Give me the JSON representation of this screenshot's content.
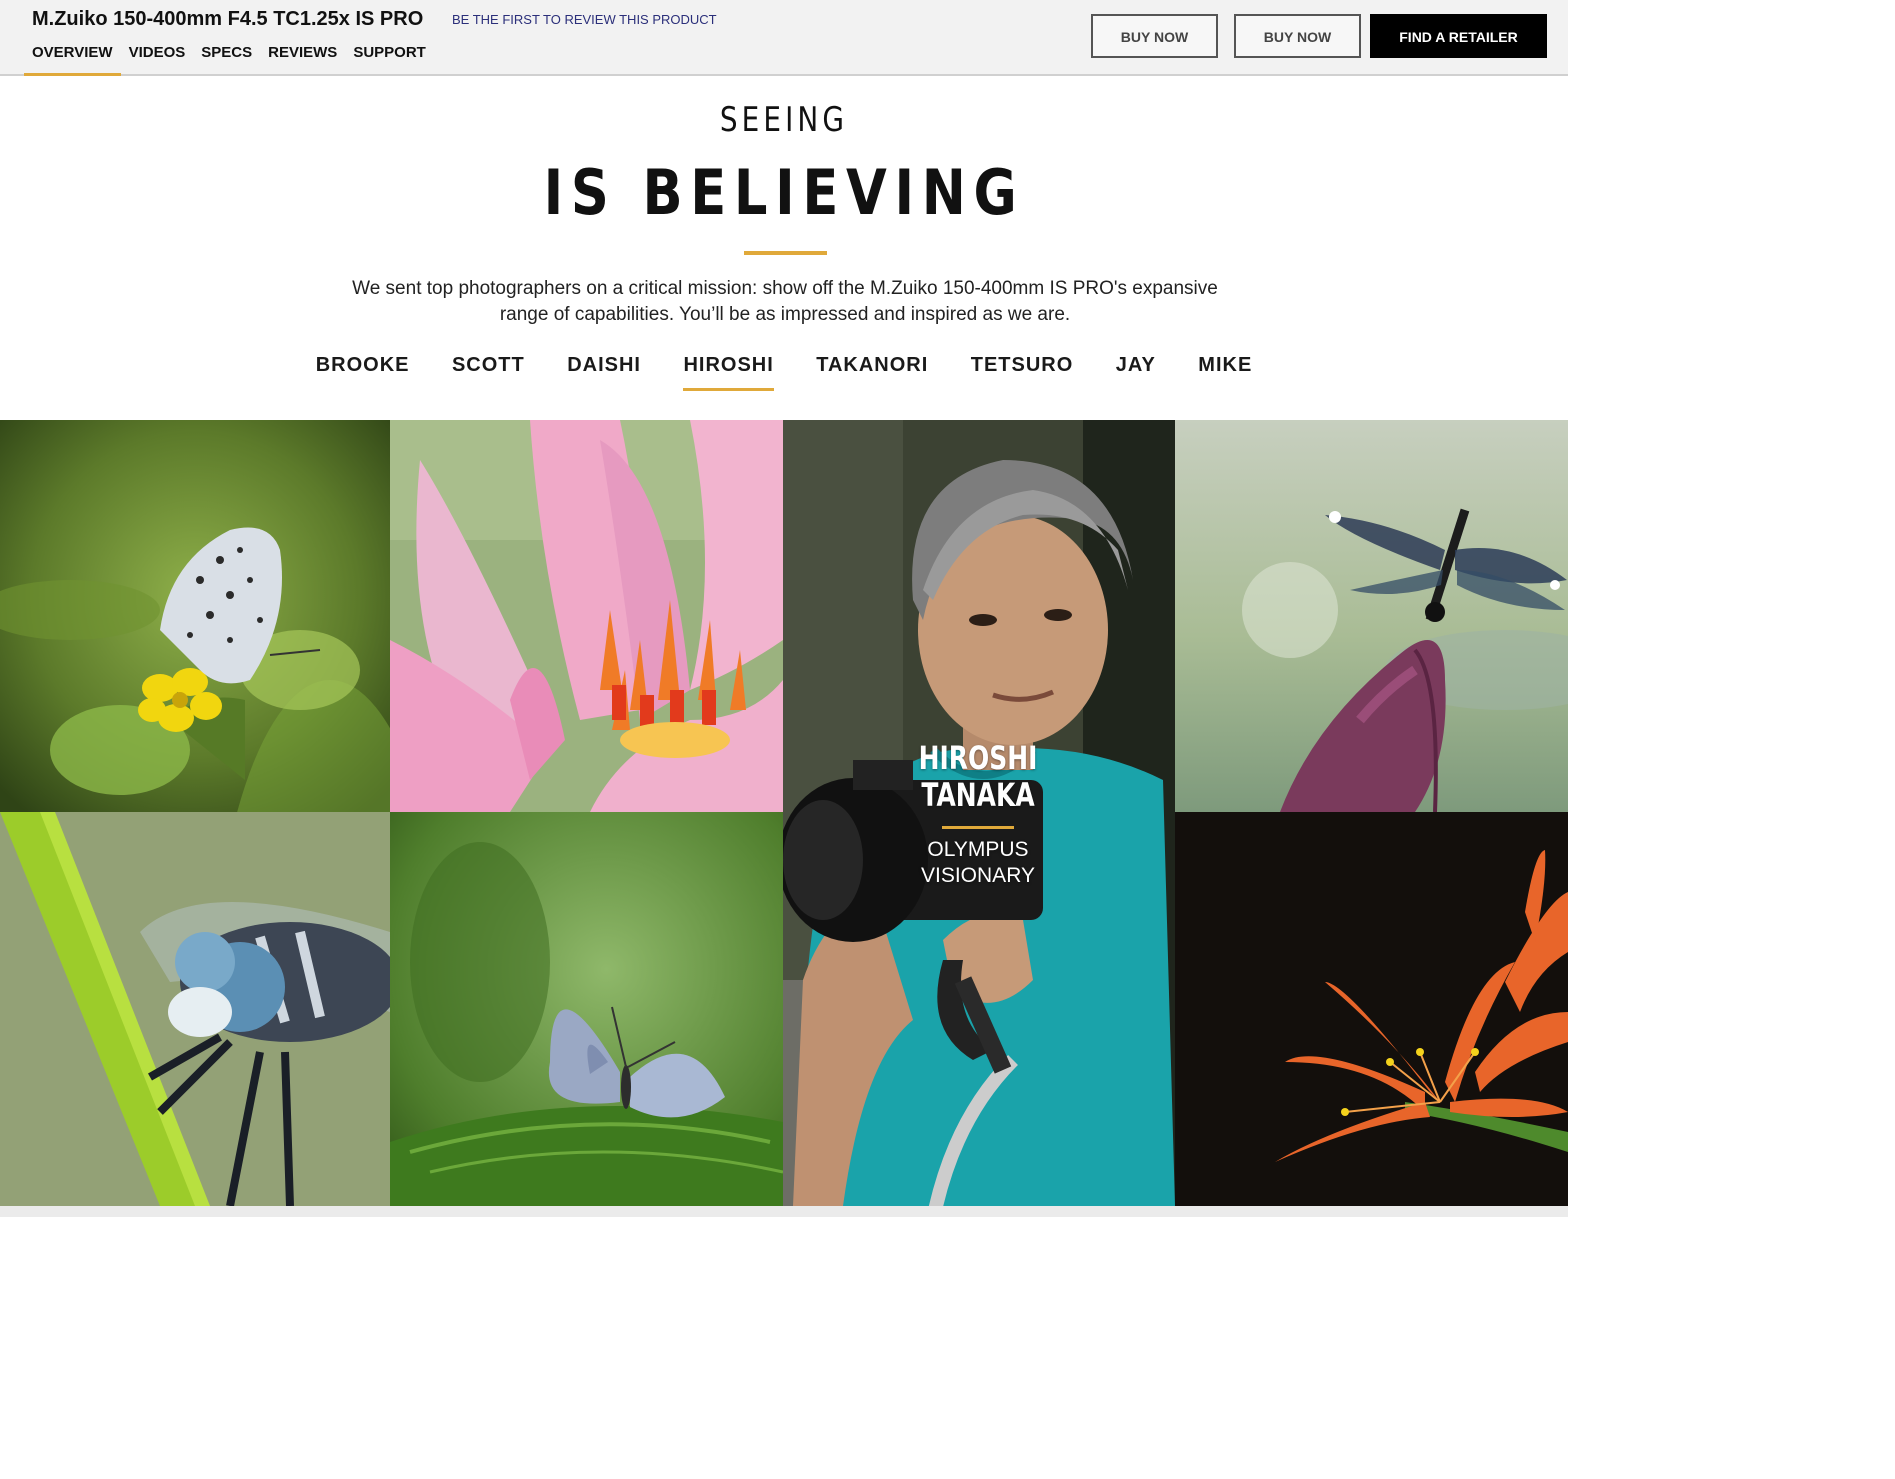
{
  "header": {
    "product_title": "M.Zuiko 150-400mm F4.5 TC1.25x IS PRO",
    "review_link": "BE THE FIRST TO REVIEW THIS PRODUCT",
    "tabs": [
      {
        "label": "OVERVIEW",
        "active": true
      },
      {
        "label": "VIDEOS",
        "active": false
      },
      {
        "label": "SPECS",
        "active": false
      },
      {
        "label": "REVIEWS",
        "active": false
      },
      {
        "label": "SUPPORT",
        "active": false
      }
    ],
    "buy_now_1": "BUY NOW",
    "buy_now_2": "BUY NOW",
    "find_retailer": "FIND A RETAILER"
  },
  "hero": {
    "heading_small": "SEEING",
    "heading_large": "IS BELIEVING",
    "intro_line1": "We sent top photographers on a critical mission: show off the M.Zuiko 150-400mm IS PRO's expansive",
    "intro_line2": "range of capabilities. You’ll be as impressed and inspired as we are.",
    "photographers": [
      {
        "name": "BROOKE",
        "active": false
      },
      {
        "name": "SCOTT",
        "active": false
      },
      {
        "name": "DAISHI",
        "active": false
      },
      {
        "name": "HIROSHI",
        "active": true
      },
      {
        "name": "TAKANORI",
        "active": false
      },
      {
        "name": "TETSURO",
        "active": false
      },
      {
        "name": "JAY",
        "active": false
      },
      {
        "name": "MIKE",
        "active": false
      }
    ]
  },
  "gallery": {
    "featured": {
      "first_name": "HIROSHI",
      "last_name": "TANAKA",
      "role_line1": "OLYMPUS",
      "role_line2": "VISIONARY"
    },
    "photos": [
      "butterfly-on-yellow-flower",
      "pink-water-lily",
      "photographer-portrait",
      "dragonfly-on-lotus-bud",
      "dragonfly-on-grass-blade",
      "blue-butterfly-on-leaf",
      "orange-spider-lily"
    ]
  },
  "colors": {
    "accent_gold": "#e0a93a",
    "header_bg": "#f2f2f2",
    "retailer_button": "#000000"
  }
}
